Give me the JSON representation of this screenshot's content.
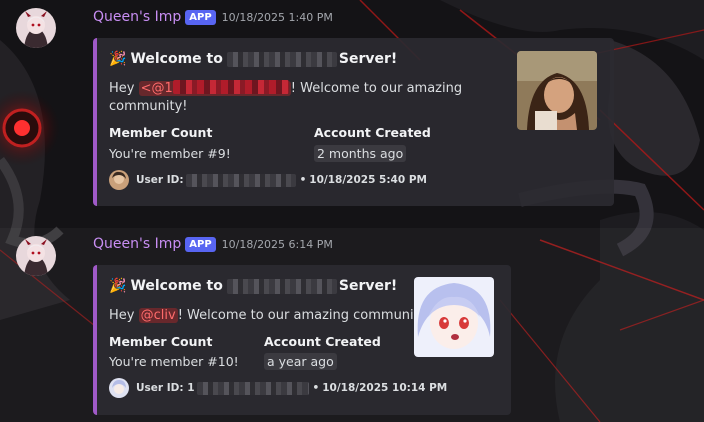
{
  "messages": [
    {
      "username": "Queen's Imp",
      "app_tag": "APP",
      "timestamp": "10/18/2025 1:40 PM",
      "embed": {
        "emoji": "🎉",
        "title_prefix": "Welcome to",
        "title_suffix": "Server!",
        "desc_prefix": "Hey",
        "mention": "<@1",
        "desc_suffix": "! Welcome to our amazing community!",
        "fields": [
          {
            "name": "Member Count",
            "value": "You're member #9!"
          },
          {
            "name": "Account Created",
            "value": "2 months ago"
          }
        ],
        "footer_prefix": "User ID:",
        "footer_sep": "•",
        "footer_time": "10/18/2025 5:40 PM"
      }
    },
    {
      "username": "Queen's Imp",
      "app_tag": "APP",
      "timestamp": "10/18/2025 6:14 PM",
      "embed": {
        "emoji": "🎉",
        "title_prefix": "Welcome to",
        "title_suffix": "Server!",
        "desc_prefix": "Hey",
        "mention": "@cliv",
        "desc_suffix": "! Welcome to our amazing community!",
        "fields": [
          {
            "name": "Member Count",
            "value": "You're member #10!"
          },
          {
            "name": "Account Created",
            "value": "a year ago"
          }
        ],
        "footer_prefix": "User ID: 1",
        "footer_sep": "•",
        "footer_time": "10/18/2025 10:14 PM"
      }
    }
  ],
  "colors": {
    "username": "#c88ef3",
    "app_tag": "#5865f2",
    "embed_accent": "#a05ac8",
    "mention": "#ff6b6b"
  }
}
